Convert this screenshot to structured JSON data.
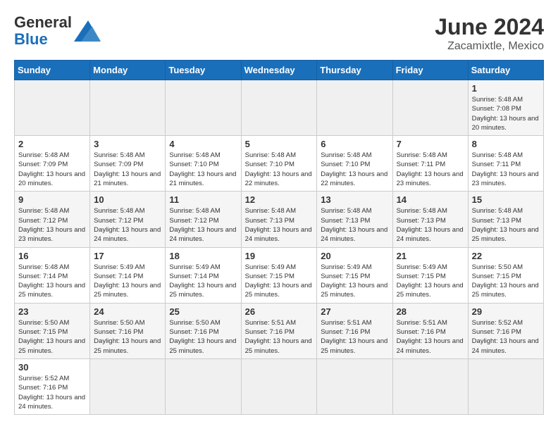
{
  "logo": {
    "text_general": "General",
    "text_blue": "Blue"
  },
  "title": {
    "month": "June 2024",
    "location": "Zacamixtle, Mexico"
  },
  "days_of_week": [
    "Sunday",
    "Monday",
    "Tuesday",
    "Wednesday",
    "Thursday",
    "Friday",
    "Saturday"
  ],
  "weeks": [
    [
      {
        "day": "",
        "info": ""
      },
      {
        "day": "",
        "info": ""
      },
      {
        "day": "",
        "info": ""
      },
      {
        "day": "",
        "info": ""
      },
      {
        "day": "",
        "info": ""
      },
      {
        "day": "",
        "info": ""
      },
      {
        "day": "1",
        "info": "Sunrise: 5:48 AM\nSunset: 7:08 PM\nDaylight: 13 hours and 20 minutes."
      }
    ],
    [
      {
        "day": "2",
        "info": "Sunrise: 5:48 AM\nSunset: 7:09 PM\nDaylight: 13 hours and 20 minutes."
      },
      {
        "day": "3",
        "info": "Sunrise: 5:48 AM\nSunset: 7:09 PM\nDaylight: 13 hours and 21 minutes."
      },
      {
        "day": "4",
        "info": "Sunrise: 5:48 AM\nSunset: 7:10 PM\nDaylight: 13 hours and 21 minutes."
      },
      {
        "day": "5",
        "info": "Sunrise: 5:48 AM\nSunset: 7:10 PM\nDaylight: 13 hours and 22 minutes."
      },
      {
        "day": "6",
        "info": "Sunrise: 5:48 AM\nSunset: 7:10 PM\nDaylight: 13 hours and 22 minutes."
      },
      {
        "day": "7",
        "info": "Sunrise: 5:48 AM\nSunset: 7:11 PM\nDaylight: 13 hours and 23 minutes."
      },
      {
        "day": "8",
        "info": "Sunrise: 5:48 AM\nSunset: 7:11 PM\nDaylight: 13 hours and 23 minutes."
      }
    ],
    [
      {
        "day": "9",
        "info": "Sunrise: 5:48 AM\nSunset: 7:12 PM\nDaylight: 13 hours and 23 minutes."
      },
      {
        "day": "10",
        "info": "Sunrise: 5:48 AM\nSunset: 7:12 PM\nDaylight: 13 hours and 24 minutes."
      },
      {
        "day": "11",
        "info": "Sunrise: 5:48 AM\nSunset: 7:12 PM\nDaylight: 13 hours and 24 minutes."
      },
      {
        "day": "12",
        "info": "Sunrise: 5:48 AM\nSunset: 7:13 PM\nDaylight: 13 hours and 24 minutes."
      },
      {
        "day": "13",
        "info": "Sunrise: 5:48 AM\nSunset: 7:13 PM\nDaylight: 13 hours and 24 minutes."
      },
      {
        "day": "14",
        "info": "Sunrise: 5:48 AM\nSunset: 7:13 PM\nDaylight: 13 hours and 24 minutes."
      },
      {
        "day": "15",
        "info": "Sunrise: 5:48 AM\nSunset: 7:13 PM\nDaylight: 13 hours and 25 minutes."
      }
    ],
    [
      {
        "day": "16",
        "info": "Sunrise: 5:48 AM\nSunset: 7:14 PM\nDaylight: 13 hours and 25 minutes."
      },
      {
        "day": "17",
        "info": "Sunrise: 5:49 AM\nSunset: 7:14 PM\nDaylight: 13 hours and 25 minutes."
      },
      {
        "day": "18",
        "info": "Sunrise: 5:49 AM\nSunset: 7:14 PM\nDaylight: 13 hours and 25 minutes."
      },
      {
        "day": "19",
        "info": "Sunrise: 5:49 AM\nSunset: 7:15 PM\nDaylight: 13 hours and 25 minutes."
      },
      {
        "day": "20",
        "info": "Sunrise: 5:49 AM\nSunset: 7:15 PM\nDaylight: 13 hours and 25 minutes."
      },
      {
        "day": "21",
        "info": "Sunrise: 5:49 AM\nSunset: 7:15 PM\nDaylight: 13 hours and 25 minutes."
      },
      {
        "day": "22",
        "info": "Sunrise: 5:50 AM\nSunset: 7:15 PM\nDaylight: 13 hours and 25 minutes."
      }
    ],
    [
      {
        "day": "23",
        "info": "Sunrise: 5:50 AM\nSunset: 7:15 PM\nDaylight: 13 hours and 25 minutes."
      },
      {
        "day": "24",
        "info": "Sunrise: 5:50 AM\nSunset: 7:16 PM\nDaylight: 13 hours and 25 minutes."
      },
      {
        "day": "25",
        "info": "Sunrise: 5:50 AM\nSunset: 7:16 PM\nDaylight: 13 hours and 25 minutes."
      },
      {
        "day": "26",
        "info": "Sunrise: 5:51 AM\nSunset: 7:16 PM\nDaylight: 13 hours and 25 minutes."
      },
      {
        "day": "27",
        "info": "Sunrise: 5:51 AM\nSunset: 7:16 PM\nDaylight: 13 hours and 25 minutes."
      },
      {
        "day": "28",
        "info": "Sunrise: 5:51 AM\nSunset: 7:16 PM\nDaylight: 13 hours and 24 minutes."
      },
      {
        "day": "29",
        "info": "Sunrise: 5:52 AM\nSunset: 7:16 PM\nDaylight: 13 hours and 24 minutes."
      }
    ],
    [
      {
        "day": "30",
        "info": "Sunrise: 5:52 AM\nSunset: 7:16 PM\nDaylight: 13 hours and 24 minutes."
      },
      {
        "day": "",
        "info": ""
      },
      {
        "day": "",
        "info": ""
      },
      {
        "day": "",
        "info": ""
      },
      {
        "day": "",
        "info": ""
      },
      {
        "day": "",
        "info": ""
      },
      {
        "day": "",
        "info": ""
      }
    ]
  ]
}
